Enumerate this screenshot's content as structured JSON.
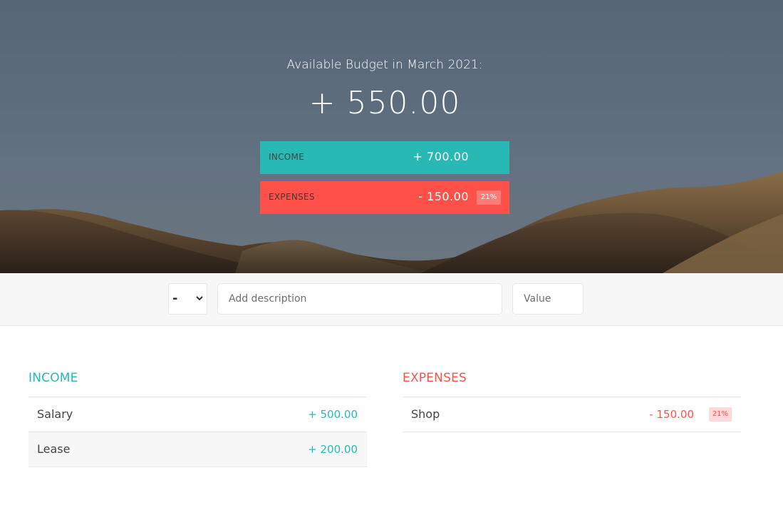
{
  "budget": {
    "title": "Available Budget in March 2021:",
    "value": "+ 550.00",
    "income": {
      "label": "INCOME",
      "value": "+ 700.00"
    },
    "expenses": {
      "label": "EXPENSES",
      "value": "- 150.00",
      "percentage": "21%"
    }
  },
  "add": {
    "type_value": "-",
    "type_icon": "chevron-down-icon",
    "description_placeholder": "Add description",
    "value_placeholder": "Value"
  },
  "income": {
    "title": "INCOME",
    "items": [
      {
        "description": "Salary",
        "value": "+ 500.00"
      },
      {
        "description": "Lease",
        "value": "+ 200.00"
      }
    ]
  },
  "expenses": {
    "title": "EXPENSES",
    "items": [
      {
        "description": "Shop",
        "value": "- 150.00",
        "percentage": "21%"
      }
    ]
  },
  "colors": {
    "income": "#28b9b5",
    "expenses": "#ff5049"
  }
}
